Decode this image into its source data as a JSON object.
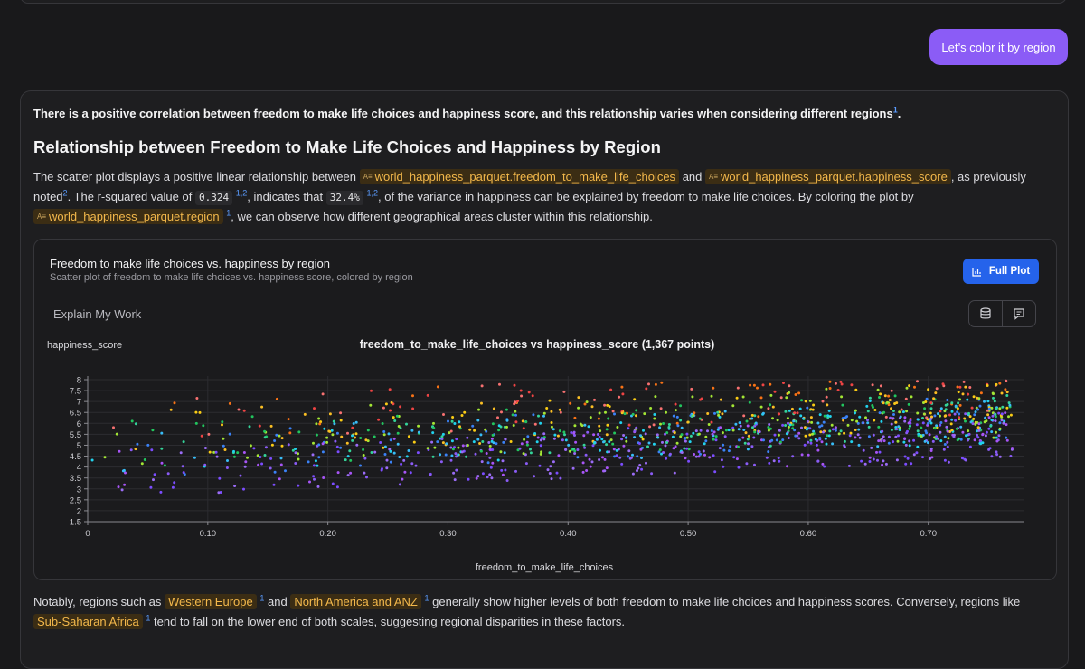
{
  "user_message": "Let’s color it by region",
  "answer": {
    "summary": "There is a positive correlation between freedom to make life choices and happiness score, and this relationship varies when considering different regions",
    "summary_ref": "1",
    "heading": "Relationship between Freedom to Make Life Choices and Happiness by Region",
    "p1_a": "The scatter plot displays a positive linear relationship between",
    "chip_freedom": "world_happiness_parquet.freedom_to_make_life_choices",
    "p1_and": "and",
    "chip_happiness": "world_happiness_parquet.happiness_score",
    "p1_b": ", as previously noted",
    "p1_ref": "2",
    "p1_c": ". The r-squared value of",
    "r2": "0.324",
    "ref_1": "1",
    "ref_2": "2",
    "p1_d": "indicates that",
    "pct": "32.4%",
    "p1_e": "of the variance in happiness can be explained by freedom to make life choices. By coloring the plot by",
    "chip_region": "world_happiness_parquet.region",
    "p1_f": "we can observe how different geographical areas cluster within this relationship.",
    "p2_a": "Notably, regions such as",
    "chip_we": "Western Europe",
    "p2_and": "and",
    "chip_na": "North America and ANZ",
    "p2_b": "generally show higher levels of both freedom to make life choices and happiness scores. Conversely, regions like",
    "chip_ssa": "Sub-Saharan Africa",
    "p2_c": "tend to fall on the lower end of both scales, suggesting regional disparities in these factors."
  },
  "chart_card": {
    "title": "Freedom to make life choices vs. happiness by region",
    "subtitle": "Scatter plot of freedom to make life choices vs. happiness score, colored by region",
    "full_plot_label": "Full Plot",
    "explain_label": "Explain My Work",
    "icons": [
      "chart-bar-icon",
      "database-icon",
      "comment-icon"
    ]
  },
  "chart_data": {
    "type": "scatter",
    "title": "freedom_to_make_life_choices vs happiness_score (1,367 points)",
    "xlabel": "freedom_to_make_life_choices",
    "ylabel": "happiness_score",
    "xlim": [
      0,
      0.78
    ],
    "ylim": [
      1.5,
      8
    ],
    "x_ticks": [
      "0",
      "0.10",
      "0.20",
      "0.30",
      "0.40",
      "0.50",
      "0.60",
      "0.70"
    ],
    "y_ticks": [
      "1.5",
      "2",
      "2.5",
      "3",
      "3.5",
      "4",
      "4.5",
      "5",
      "5.5",
      "6",
      "6.5",
      "7",
      "7.5",
      "8"
    ],
    "point_count": 1367,
    "color_by": "region",
    "grid": true
  }
}
